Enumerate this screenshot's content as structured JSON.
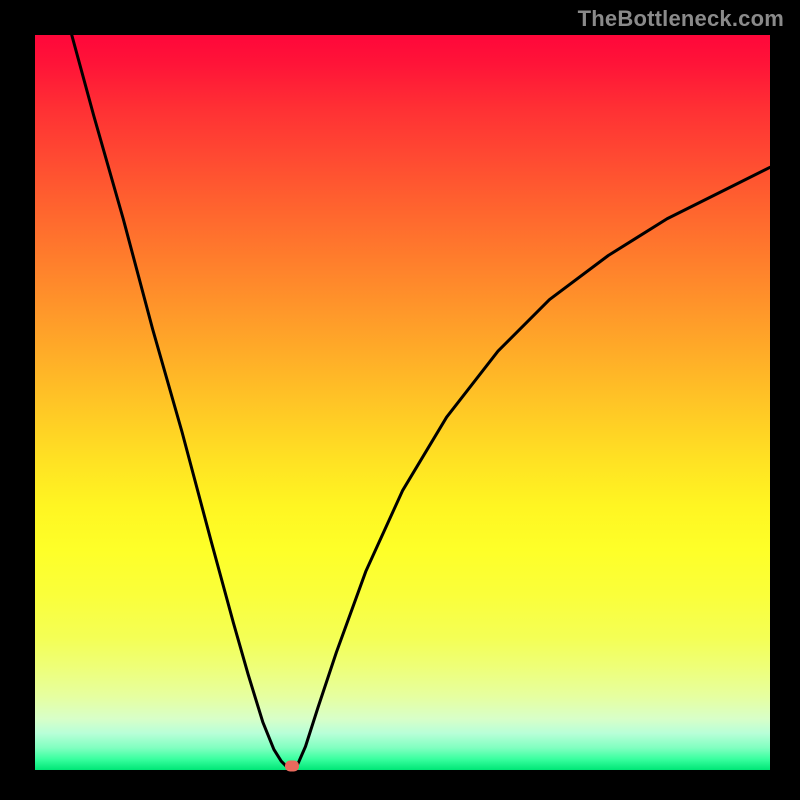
{
  "watermark": "TheBottleneck.com",
  "chart_data": {
    "type": "line",
    "title": "",
    "xlabel": "",
    "ylabel": "",
    "xlim": [
      0,
      100
    ],
    "ylim": [
      0,
      100
    ],
    "grid": false,
    "legend": false,
    "series": [
      {
        "name": "bottleneck-curve",
        "x": [
          5,
          8,
          12,
          16,
          20,
          24,
          27,
          29,
          31,
          32.5,
          33.5,
          34.3,
          34.8,
          35,
          35.2,
          35.8,
          36.8,
          38.5,
          41,
          45,
          50,
          56,
          63,
          70,
          78,
          86,
          94,
          100
        ],
        "y": [
          100,
          89,
          75,
          60,
          46,
          31,
          20,
          13,
          6.5,
          2.8,
          1.2,
          0.4,
          0.08,
          0.02,
          0.1,
          0.9,
          3.2,
          8.5,
          16,
          27,
          38,
          48,
          57,
          64,
          70,
          75,
          79,
          82
        ]
      }
    ],
    "marker": {
      "x": 35,
      "y": 0.6,
      "color": "#e96a5d"
    },
    "background_gradient": {
      "top": "#ff073a",
      "bottom": "#00e676"
    }
  }
}
